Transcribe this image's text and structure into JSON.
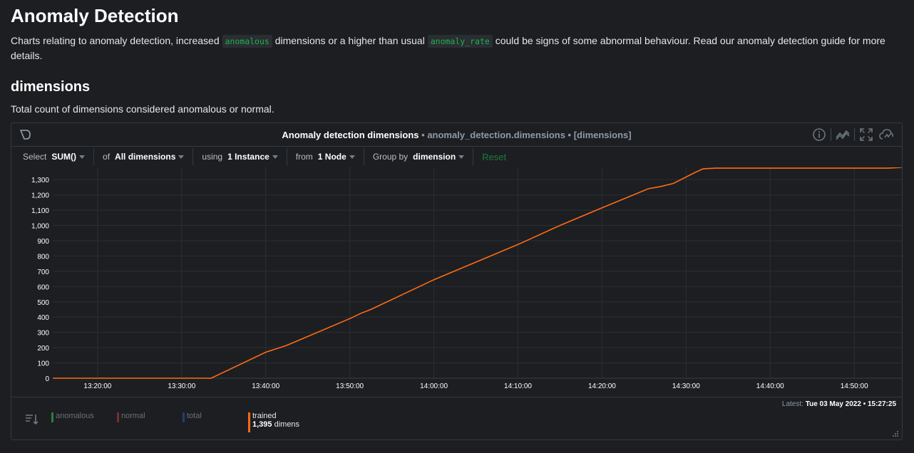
{
  "page": {
    "title": "Anomaly Detection",
    "intro_prefix": "Charts relating to anomaly detection, increased ",
    "intro_code1": "anomalous",
    "intro_mid": " dimensions or a higher than usual ",
    "intro_code2": "anomaly_rate",
    "intro_suffix": " could be signs of some abnormal behaviour. Read our anomaly detection guide for more details."
  },
  "section": {
    "title": "dimensions",
    "description": "Total count of dimensions considered anomalous or normal."
  },
  "card": {
    "title": "Anomaly detection dimensions",
    "subtitle": " • anomaly_detection.dimensions • [dimensions]",
    "icons": [
      "info-icon",
      "correlation-icon",
      "fullscreen-icon",
      "alert-icon"
    ]
  },
  "toolbar": {
    "select_label": "Select",
    "select_value": "SUM()",
    "of_label": "of",
    "of_value": "All dimensions",
    "using_label": "using",
    "using_value": "1 Instance",
    "from_label": "from",
    "from_value": "1 Node",
    "group_label": "Group by",
    "group_value": "dimension",
    "reset_label": "Reset"
  },
  "legend": {
    "items": [
      {
        "name": "anomalous",
        "color": "#2c7d3e"
      },
      {
        "name": "normal",
        "color": "#7a2e2e"
      },
      {
        "name": "total",
        "color": "#283c73"
      }
    ],
    "trained": {
      "name": "trained",
      "value": "1,395",
      "unit": "dimens",
      "color": "#ff6b12"
    },
    "latest_label": "Latest:",
    "latest_value": "Tue 03 May 2022 • 15:27:25"
  },
  "chart_data": {
    "type": "line",
    "ylim": [
      0,
      1380
    ],
    "yticks": [
      0,
      100,
      200,
      300,
      400,
      500,
      600,
      700,
      800,
      900,
      1000,
      1100,
      1200,
      1300
    ],
    "ytick_labels": [
      "0",
      "100",
      "200",
      "300",
      "400",
      "500",
      "600",
      "700",
      "800",
      "900",
      "1,000",
      "1,100",
      "1,200",
      "1,300"
    ],
    "xlim": [
      "13:14:40",
      "14:55:40"
    ],
    "xticks": [
      "13:20:00",
      "13:30:00",
      "13:40:00",
      "13:50:00",
      "14:00:00",
      "14:10:00",
      "14:20:00",
      "14:30:00",
      "14:40:00",
      "14:50:00"
    ],
    "series": [
      {
        "name": "trained",
        "color": "#ff6b12",
        "x": [
          "13:14:40",
          "13:33:30",
          "13:40:00",
          "13:42:30",
          "13:44:00",
          "13:50:00",
          "13:51:20",
          "13:52:30",
          "14:00:00",
          "14:05:00",
          "14:10:00",
          "14:15:00",
          "14:20:00",
          "14:25:30",
          "14:27:00",
          "14:28:30",
          "14:31:00",
          "14:32:00",
          "14:33:30",
          "14:54:00",
          "14:55:40"
        ],
        "values": [
          0,
          0,
          170,
          215,
          250,
          390,
          425,
          450,
          645,
          760,
          875,
          1000,
          1115,
          1240,
          1255,
          1275,
          1345,
          1370,
          1375,
          1375,
          1380
        ]
      }
    ]
  }
}
